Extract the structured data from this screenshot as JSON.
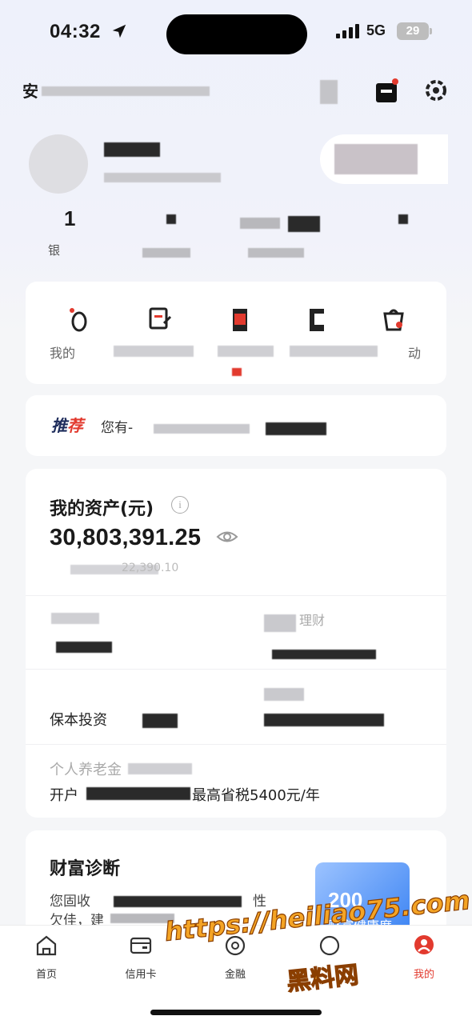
{
  "status_bar": {
    "time": "04:32",
    "network": "5G",
    "battery": "29"
  },
  "header": {
    "greeting_prefix": "安"
  },
  "profile": {
    "stat_first_value": "1",
    "stat_first_label_prefix": "银"
  },
  "services": {
    "items": [
      {
        "icon": "footprint-icon",
        "label": "我的"
      },
      {
        "icon": "document-edit-icon",
        "label": ""
      },
      {
        "icon": "bookmark-icon",
        "label": ""
      },
      {
        "icon": "card-icon",
        "label": ""
      },
      {
        "icon": "gift-bag-icon",
        "label": "动"
      }
    ]
  },
  "recommend": {
    "tag_a": "推",
    "tag_b": "荐",
    "text": "您有-"
  },
  "assets": {
    "title": "我的资产(元)",
    "total": "30,803,391.25",
    "sub_suffix": "22,390.10",
    "cell_financial": "理财",
    "cell_guaranteed": "保本投资",
    "cell_pension_title": "个人养老金",
    "cell_pension_line": "开户",
    "cell_pension_suffix": "最高省税5400元/年"
  },
  "diagnosis": {
    "title": "财富诊断",
    "line1": "您固收",
    "line1_suffix": "性",
    "line2": "欠佳，建",
    "health_score": "200",
    "health_label": "财富健康度"
  },
  "tabbar": {
    "items": [
      {
        "label": "首页",
        "icon": "home-icon"
      },
      {
        "label": "信用卡",
        "icon": "credit-card-icon"
      },
      {
        "label": "金融",
        "icon": "coin-icon"
      },
      {
        "label": "",
        "icon": "life-icon"
      },
      {
        "label": "我的",
        "icon": "user-icon",
        "active": true
      }
    ]
  },
  "watermark": {
    "line1": "https://heiliao75.com",
    "line2": "黑料网"
  },
  "colors": {
    "accent": "#e23a2e",
    "navy": "#1f2d5c",
    "background": "#f5f6f8"
  }
}
